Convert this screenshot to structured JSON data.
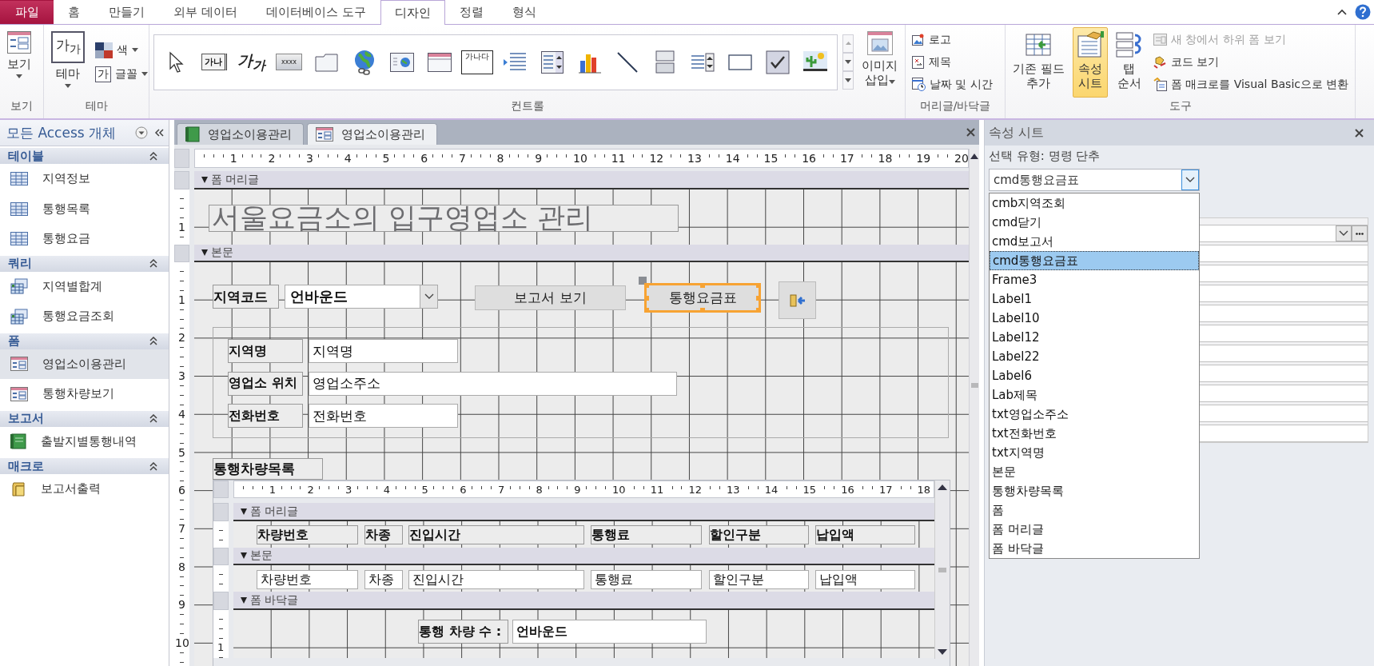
{
  "ribbon_tabs": [
    {
      "label": "파일",
      "kind": "file",
      "selected": false
    },
    {
      "label": "홈",
      "kind": "tab",
      "selected": false
    },
    {
      "label": "만들기",
      "kind": "tab",
      "selected": false
    },
    {
      "label": "외부 데이터",
      "kind": "tab",
      "selected": false
    },
    {
      "label": "데이터베이스 도구",
      "kind": "tab",
      "selected": false
    },
    {
      "label": "디자인",
      "kind": "tab",
      "selected": true
    },
    {
      "label": "정렬",
      "kind": "tab",
      "selected": false
    },
    {
      "label": "형식",
      "kind": "tab",
      "selected": false
    }
  ],
  "view_group": {
    "button": "보기",
    "label": "보기"
  },
  "theme_group": {
    "button": "테마",
    "thumb_glyph": "가$_{가}$",
    "colors": "색",
    "fonts_glyph": "가",
    "fonts": "글꼴",
    "label": "테마"
  },
  "controls_group": {
    "gallery": [
      {
        "kind": "pointer"
      },
      {
        "kind": "textbox",
        "glyph": "가나"
      },
      {
        "kind": "label",
        "glyph": "가$_{가}$"
      },
      {
        "kind": "button",
        "glyph": "xxxx"
      },
      {
        "kind": "tab"
      },
      {
        "kind": "hyperlink"
      },
      {
        "kind": "browser"
      },
      {
        "kind": "navigation"
      },
      {
        "kind": "group",
        "glyph": "가나다"
      },
      {
        "kind": "pagebreak"
      },
      {
        "kind": "combo"
      },
      {
        "kind": "chart"
      },
      {
        "kind": "line"
      },
      {
        "kind": "toggle"
      },
      {
        "kind": "listbox"
      },
      {
        "kind": "rectangle"
      },
      {
        "kind": "checkbox"
      },
      {
        "kind": "image"
      }
    ],
    "insert_image": "이미지\n삽입",
    "label": "컨트롤"
  },
  "header_footer_group": {
    "items": [
      {
        "kind": "logo",
        "label": "로고"
      },
      {
        "kind": "title",
        "label": "제목"
      },
      {
        "kind": "datetime",
        "label": "날짜 및 시간"
      }
    ],
    "label": "머리글/바닥글"
  },
  "tools_group": {
    "large": [
      {
        "kind": "fields",
        "label": "기존 필드\n추가",
        "selected": false
      },
      {
        "kind": "sheet",
        "label": "속성\n시트",
        "selected": true
      },
      {
        "kind": "taborder",
        "label": "탭\n순서",
        "selected": false
      }
    ],
    "small": [
      {
        "kind": "subform",
        "label": "새 창에서 하위 폼 보기",
        "disabled": true
      },
      {
        "kind": "code",
        "label": "코드 보기",
        "disabled": false
      },
      {
        "kind": "convert",
        "label": "폼 매크로를 Visual Basic으로 변환",
        "disabled": false
      }
    ],
    "label": "도구"
  },
  "nav": {
    "title": "모든 Access 개체",
    "sections": [
      {
        "title": "테이블",
        "items": [
          {
            "label": "지역정보",
            "kind": "table",
            "selected": false
          },
          {
            "label": "통행목록",
            "kind": "table",
            "selected": false
          },
          {
            "label": "통행요금",
            "kind": "table",
            "selected": false
          }
        ]
      },
      {
        "title": "쿼리",
        "items": [
          {
            "label": "지역별합계",
            "kind": "query",
            "selected": false
          },
          {
            "label": "통행요금조회",
            "kind": "query",
            "selected": false
          }
        ]
      },
      {
        "title": "폼",
        "items": [
          {
            "label": "영업소이용관리",
            "kind": "form",
            "selected": true
          },
          {
            "label": "통행차량보기",
            "kind": "form",
            "selected": false
          }
        ]
      },
      {
        "title": "보고서",
        "items": [
          {
            "label": "출발지별통행내역",
            "kind": "report",
            "selected": false
          }
        ]
      },
      {
        "title": "매크로",
        "items": [
          {
            "label": "보고서출력",
            "kind": "macro",
            "selected": false
          }
        ]
      }
    ]
  },
  "document_tabs": [
    {
      "label": "영업소이용관리",
      "kind": "formview",
      "selected": false
    },
    {
      "label": "영업소이용관리",
      "kind": "design",
      "selected": true
    }
  ],
  "designer": {
    "ruler": [
      "1",
      "2",
      "3",
      "4",
      "5",
      "6",
      "7",
      "8",
      "9",
      "10",
      "11",
      "12",
      "13",
      "14",
      "15",
      "16",
      "17",
      "18",
      "19",
      "20"
    ],
    "header": {
      "title": "폼 머리글",
      "ruler": [
        "1"
      ],
      "title_label": "서울요금소의 입구영업소 관리"
    },
    "detail": {
      "title": "본문",
      "ruler": [
        "1",
        "2",
        "3",
        "4",
        "5",
        "6",
        "7",
        "8",
        "9",
        "10"
      ],
      "region_label": "지역코드",
      "region_value": "언바운드",
      "buttons": [
        {
          "label": "보고서 보기",
          "selected": false
        },
        {
          "label": "통행요금표",
          "selected": true
        }
      ],
      "fields": [
        {
          "label": "지역명",
          "value": "지역명"
        },
        {
          "label": "영업소 위치",
          "value": "영업소주소"
        },
        {
          "label": "전화번호",
          "value": "전화번호"
        }
      ],
      "subform": {
        "label": "통행차량목록",
        "ruler": [
          "1",
          "2",
          "3",
          "4",
          "5",
          "6",
          "7",
          "8",
          "9",
          "10",
          "11",
          "12",
          "13",
          "14",
          "15",
          "16",
          "17",
          "18"
        ],
        "header_title": "폼 머리글",
        "columns": [
          "차량번호",
          "차종",
          "진입시간",
          "통행료",
          "할인구분",
          "납입액"
        ],
        "detail_title": "본문",
        "cells": [
          "차량번호",
          "차종",
          "진입시간",
          "통행료",
          "할인구분",
          "납입액"
        ],
        "footer_title": "폼 바닥글",
        "footer_ruler": [
          "1"
        ],
        "count_label": "통행 차량 수 :",
        "count_value": "언바운드"
      }
    }
  },
  "property_sheet": {
    "title": "속성 시트",
    "selection_type": "선택 유형: 명령 단추",
    "object": "cmd통행요금표",
    "options": [
      {
        "label": "cmb지역조회",
        "selected": false
      },
      {
        "label": "cmd닫기",
        "selected": false
      },
      {
        "label": "cmd보고서",
        "selected": false
      },
      {
        "label": "cmd통행요금표",
        "selected": true
      },
      {
        "label": "Frame3",
        "selected": false
      },
      {
        "label": "Label1",
        "selected": false
      },
      {
        "label": "Label10",
        "selected": false
      },
      {
        "label": "Label12",
        "selected": false
      },
      {
        "label": "Label22",
        "selected": false
      },
      {
        "label": "Label6",
        "selected": false
      },
      {
        "label": "Lab제목",
        "selected": false
      },
      {
        "label": "txt영업소주소",
        "selected": false
      },
      {
        "label": "txt전화번호",
        "selected": false
      },
      {
        "label": "txt지역명",
        "selected": false
      },
      {
        "label": "본문",
        "selected": false
      },
      {
        "label": "통행차량목록",
        "selected": false
      },
      {
        "label": "폼",
        "selected": false
      },
      {
        "label": "폼 머리글",
        "selected": false
      },
      {
        "label": "폼 바닥글",
        "selected": false
      }
    ]
  }
}
